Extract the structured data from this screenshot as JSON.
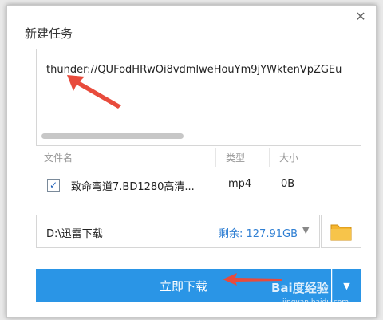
{
  "dialog": {
    "title": "新建任务"
  },
  "url_input": {
    "value": "thunder://QUFodHRwOi8vdmlweHouYm9jYWktenVpZGEu"
  },
  "file_list": {
    "headers": [
      "文件名",
      "类型",
      "大小"
    ],
    "rows": [
      {
        "name": "致命弯道7.BD1280高清...",
        "type": "mp4",
        "size": "0B",
        "checked": true
      }
    ]
  },
  "save_path": {
    "path": "D:\\迅雷下载",
    "free_space": "剩余: 127.91GB"
  },
  "actions": {
    "download_now": "立即下载"
  },
  "watermark": {
    "brand": "Bai度经验",
    "url": "jingyan.baidu.com"
  },
  "colors": {
    "accent": "#2a95e6",
    "annotation_arrow": "#e84b3c",
    "free_space_text": "#2f7fd3"
  },
  "icons": {
    "close": "close-icon",
    "folder": "folder-icon",
    "dropdown": "chevron-down-icon",
    "check": "check-icon"
  }
}
